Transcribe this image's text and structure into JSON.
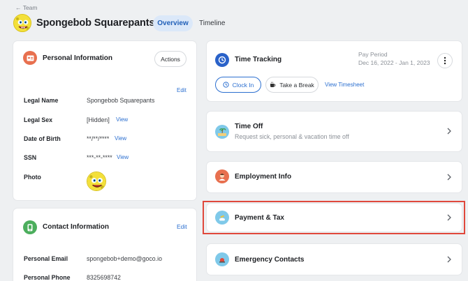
{
  "header": {
    "back_label": "← Team",
    "title": "Spongebob Squarepants",
    "tabs": [
      {
        "label": "Overview",
        "active": true
      },
      {
        "label": "Timeline",
        "active": false
      }
    ]
  },
  "personal": {
    "title": "Personal Information",
    "actions_label": "Actions",
    "edit_label": "Edit",
    "rows": [
      {
        "label": "Legal Name",
        "value": "Spongebob Squarepants",
        "link": ""
      },
      {
        "label": "Legal Sex",
        "value": "[Hidden]",
        "link": "View"
      },
      {
        "label": "Date of Birth",
        "value": "**/**/****",
        "link": "View"
      },
      {
        "label": "SSN",
        "value": "***-**-****",
        "link": "View"
      },
      {
        "label": "Photo",
        "value": "",
        "link": ""
      }
    ]
  },
  "contact": {
    "title": "Contact Information",
    "edit_label": "Edit",
    "rows": [
      {
        "label": "Personal Email",
        "value": "spongebob+demo@goco.io"
      },
      {
        "label": "Personal Phone",
        "value": "8325698742"
      }
    ]
  },
  "time_tracking": {
    "title": "Time Tracking",
    "pay_period_label": "Pay Period",
    "pay_period_value": "Dec 16, 2022 - Jan 1, 2023",
    "clock_in_label": "Clock In",
    "break_label": "Take a Break",
    "timesheet_label": "View Timesheet"
  },
  "time_off": {
    "title": "Time Off",
    "subtitle": "Request sick, personal & vacation time off"
  },
  "employment": {
    "title": "Employment Info"
  },
  "payment": {
    "title": "Payment & Tax",
    "highlighted": true
  },
  "emergency": {
    "title": "Emergency Contacts"
  },
  "colors": {
    "accent": "#2b6fd0",
    "highlight_border": "#e0483c",
    "tab_active_bg": "#dbe8f9"
  }
}
